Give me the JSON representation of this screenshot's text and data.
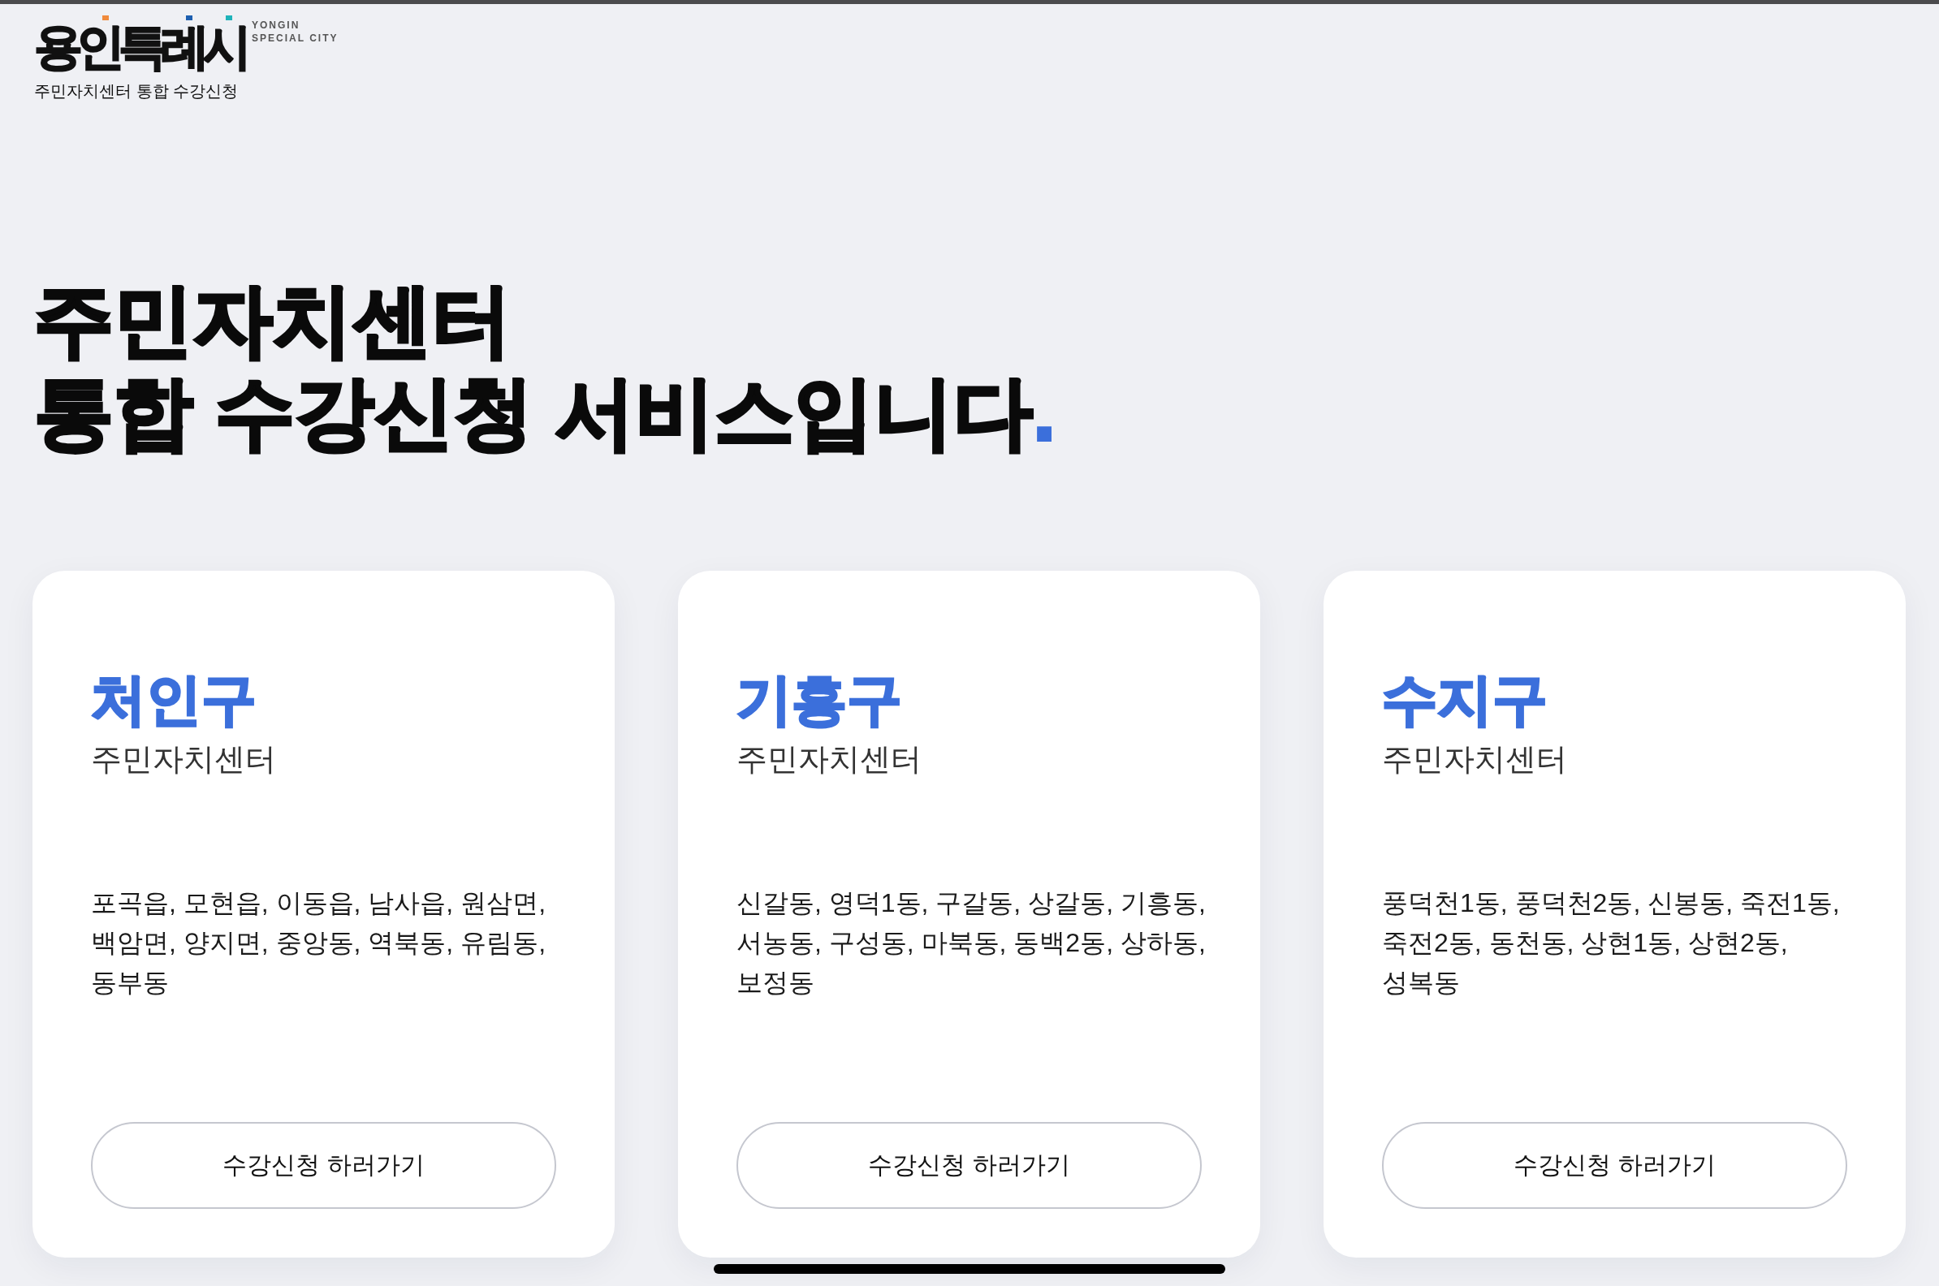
{
  "header": {
    "logo": {
      "wordmark": "용인특례시",
      "tagline_lines": [
        "YONGIN",
        "SPECIAL CITY"
      ],
      "accents": [
        {
          "color": "#f08a3c"
        },
        {
          "color": "#1d5fb0"
        },
        {
          "color": "#1fb3ba"
        }
      ]
    },
    "service_name": "주민자치센터 통합 수강신청"
  },
  "hero": {
    "title_lines": [
      "주민자치센터",
      "통합 수강신청 서비스입니다"
    ],
    "end_mark": "."
  },
  "districts": [
    {
      "name": "처인구",
      "subtitle": "주민자치센터",
      "areas": [
        "포곡읍, 모현읍, 이동읍, 남사읍, 원삼면,",
        "백암면, 양지면, 중앙동, 역북동, 유림동,",
        "동부동"
      ],
      "button": "수강신청 하러가기"
    },
    {
      "name": "기흥구",
      "subtitle": "주민자치센터",
      "areas": [
        "신갈동, 영덕1동, 구갈동, 상갈동, 기흥동,",
        "서농동, 구성동, 마북동, 동백2동, 상하동,",
        "보정동"
      ],
      "button": "수강신청 하러가기"
    },
    {
      "name": "수지구",
      "subtitle": "주민자치센터",
      "areas": [
        "풍덕천1동, 풍덕천2동, 신봉동, 죽전1동,",
        "죽전2동, 동천동, 상현1동, 상현2동,",
        "성복동"
      ],
      "button": "수강신청 하러가기"
    }
  ]
}
